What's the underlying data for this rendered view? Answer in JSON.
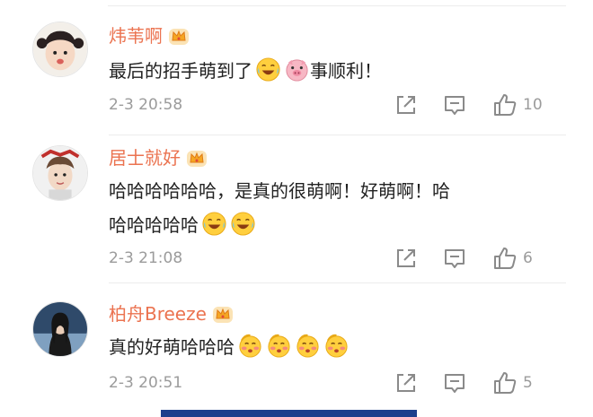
{
  "comments": [
    {
      "username": "炜苇啊",
      "text_before_emojis": "最后的招手萌到了",
      "text_after_emojis": "事顺利！",
      "emojis": [
        "laughing-tears-emoji",
        "pig-emoji"
      ],
      "timestamp": "2-3 20:58",
      "like_count": "10"
    },
    {
      "username": "居士就好",
      "text_line1": "哈哈哈哈哈哈，是真的很萌啊！好萌啊！哈",
      "text_line2": "哈哈哈哈哈",
      "emojis": [
        "laughing-tears-emoji",
        "laughing-tears-emoji"
      ],
      "timestamp": "2-3 21:08",
      "like_count": "6"
    },
    {
      "username": "柏舟Breeze",
      "text": "真的好萌哈哈哈",
      "emojis": [
        "blushing-emoji",
        "blushing-emoji",
        "blushing-emoji",
        "blushing-emoji"
      ],
      "timestamp": "2-3 20:51",
      "like_count": "5"
    }
  ],
  "colors": {
    "username": "#eb7350",
    "meta_text": "#9b9b9b",
    "icon_stroke": "#8a8a8a",
    "vip_badge": "#f5a623",
    "banner": "#1b3f8c"
  },
  "icons": {
    "vip_badge": "crown-badge-icon",
    "share": "share-icon",
    "reply": "comment-icon",
    "like": "thumbs-up-icon"
  }
}
